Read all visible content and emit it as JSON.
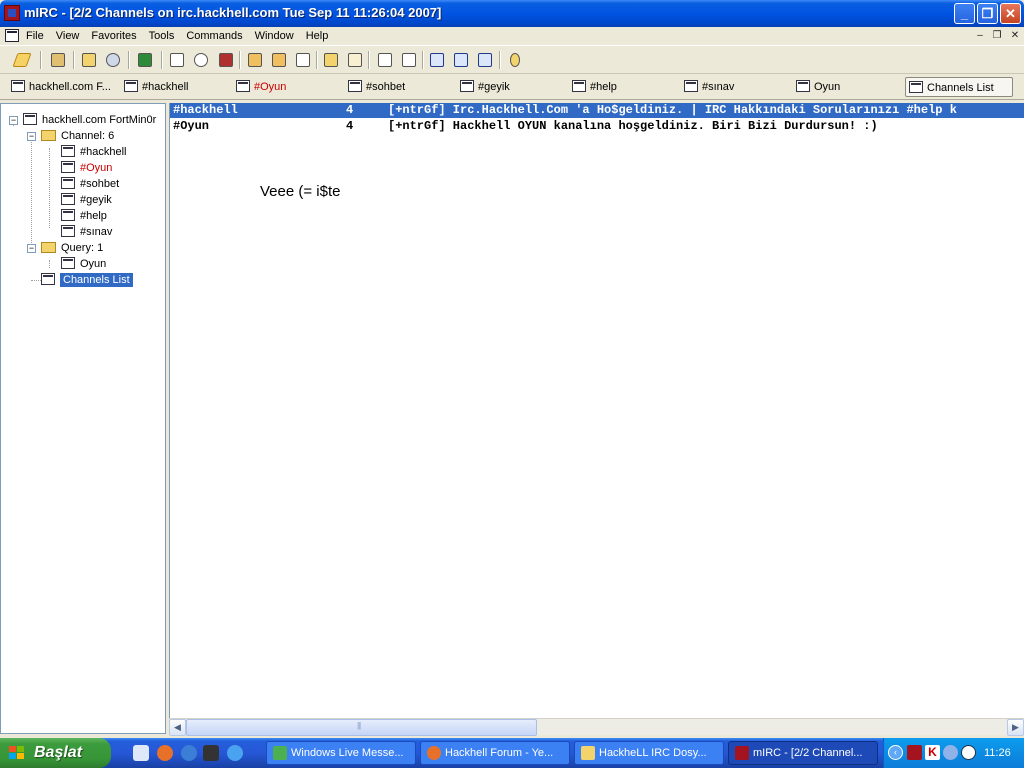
{
  "window": {
    "title": "mIRC - [2/2 Channels on irc.hackhell.com Tue Sep 11 11:26:04 2007]"
  },
  "menu": [
    "File",
    "View",
    "Favorites",
    "Tools",
    "Commands",
    "Window",
    "Help"
  ],
  "switchbar": [
    {
      "label": "hackhell.com F...",
      "color": "#000000",
      "icon": "server-icon"
    },
    {
      "label": "#hackhell",
      "color": "#000000",
      "icon": "channel-icon"
    },
    {
      "label": "#Oyun",
      "color": "#cc0000",
      "icon": "channel-icon"
    },
    {
      "label": "#sohbet",
      "color": "#000000",
      "icon": "channel-icon"
    },
    {
      "label": "#geyik",
      "color": "#000000",
      "icon": "channel-icon"
    },
    {
      "label": "#help",
      "color": "#000000",
      "icon": "channel-icon"
    },
    {
      "label": "#sınav",
      "color": "#000000",
      "icon": "channel-icon"
    },
    {
      "label": "Oyun",
      "color": "#000000",
      "icon": "query-icon"
    },
    {
      "label": "Channels List",
      "color": "#000000",
      "icon": "channels-list-icon",
      "active": true
    }
  ],
  "tree": {
    "server": "hackhell.com FortMin0r",
    "channel_group": "Channel: 6",
    "channels": [
      {
        "label": "#hackhell",
        "color": "#000000"
      },
      {
        "label": "#Oyun",
        "color": "#cc0000"
      },
      {
        "label": "#sohbet",
        "color": "#000000"
      },
      {
        "label": "#geyik",
        "color": "#000000"
      },
      {
        "label": "#help",
        "color": "#000000"
      },
      {
        "label": "#sınav",
        "color": "#000000"
      }
    ],
    "query_group": "Query: 1",
    "queries": [
      {
        "label": "Oyun"
      }
    ],
    "channels_list": "Channels List"
  },
  "channel_list": {
    "rows": [
      {
        "channel": "#hackhell",
        "users": "4",
        "topic": "[+ntrGf]  Irc.Hackhell.Com 'a Ho$geldiniz. | IRC Hakkındaki Sorularınızı #help k",
        "selected": true
      },
      {
        "channel": "#Oyun",
        "users": "4",
        "topic": "[+ntrGf] Hackhell OYUN kanalına hoşgeldiniz. Biri Bizi Durdursun! :)",
        "selected": false
      }
    ]
  },
  "floating_text": "Veee (= i$te",
  "taskbar": {
    "start_label": "Başlat",
    "tasks": [
      {
        "label": "Windows Live Messe...",
        "icon": "messenger-icon",
        "color": "#4caf50"
      },
      {
        "label": "Hackhell Forum - Ye...",
        "icon": "firefox-icon",
        "color": "#e8712a"
      },
      {
        "label": "HackheLL IRC Dosy...",
        "icon": "folder-icon",
        "color": "#f3d36b"
      },
      {
        "label": "mIRC - [2/2 Channel...",
        "icon": "mirc-icon",
        "color": "#a4141e",
        "active": true
      }
    ],
    "clock": "11:26"
  }
}
